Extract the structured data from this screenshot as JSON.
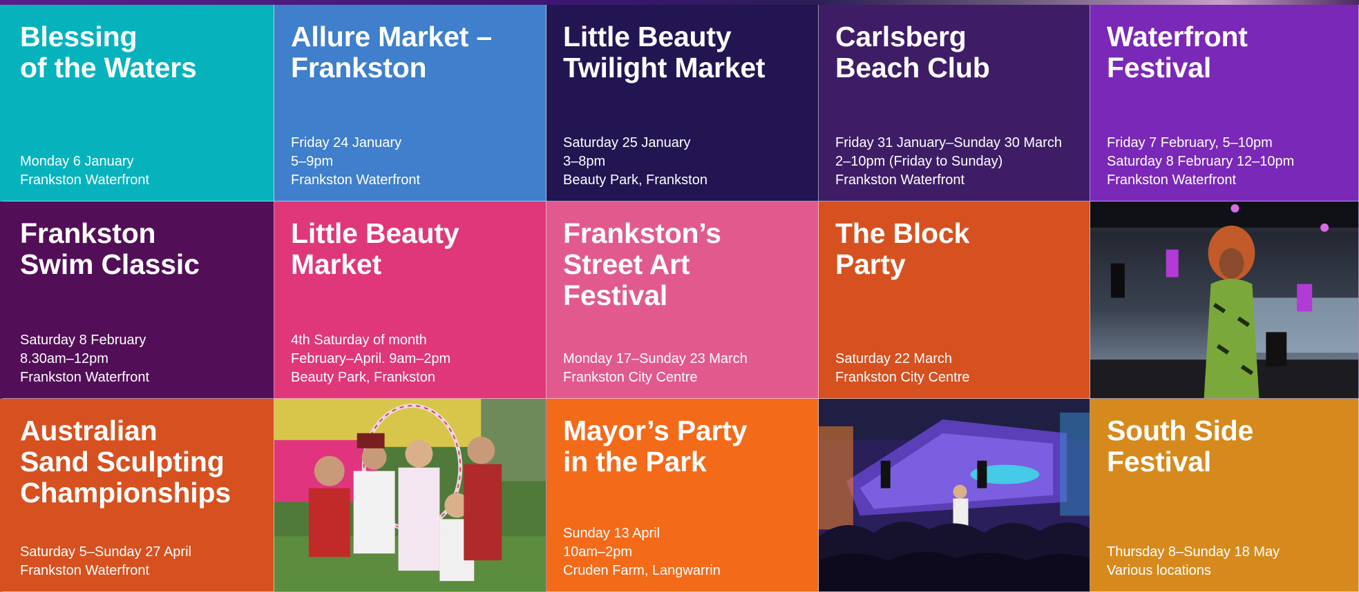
{
  "colors": {
    "teal": "#06b3bd",
    "blue": "#3f7fcb",
    "dark_navy": "#231552",
    "dark_purple": "#3e1d66",
    "purple": "#7a28b8",
    "plum": "#520f57",
    "pink": "#df3779",
    "light_pink": "#e25a8d",
    "burnt_orange": "#d6511f",
    "orange": "#f36a19",
    "mustard": "#d68a1d"
  },
  "events": [
    {
      "title": "Blessing\nof the Waters",
      "details": [
        "Monday 6 January",
        "Frankston Waterfront"
      ]
    },
    {
      "title": "Allure Market –\nFrankston",
      "details": [
        "Friday 24 January",
        "5–9pm",
        "Frankston Waterfront"
      ]
    },
    {
      "title": "Little Beauty\nTwilight Market",
      "details": [
        "Saturday 25 January",
        "3–8pm",
        "Beauty Park, Frankston"
      ]
    },
    {
      "title": "Carlsberg\nBeach Club",
      "details": [
        "Friday 31 January–Sunday 30 March",
        "2–10pm (Friday to Sunday)",
        "Frankston Waterfront"
      ]
    },
    {
      "title": "Waterfront\nFestival",
      "details": [
        "Friday 7 February, 5–10pm",
        "Saturday 8 February 12–10pm",
        "Frankston Waterfront"
      ]
    },
    {
      "title": "Frankston\nSwim Classic",
      "details": [
        "Saturday 8 February",
        "8.30am–12pm",
        "Frankston Waterfront"
      ]
    },
    {
      "title": "Little Beauty\nMarket",
      "details": [
        "4th Saturday of month",
        "February–April. 9am–2pm",
        "Beauty Park, Frankston"
      ]
    },
    {
      "title": "Frankston’s\nStreet Art\nFestival",
      "details": [
        "Monday 17–Sunday 23 March",
        "Frankston City Centre"
      ]
    },
    {
      "title": "The Block\nParty",
      "details": [
        "Saturday 22 March",
        "Frankston City Centre"
      ]
    },
    {
      "title": "Australian\nSand Sculpting\nChampionships",
      "details": [
        "Saturday 5–Sunday 27 April",
        "Frankston Waterfront"
      ]
    },
    {
      "title": "Mayor’s Party\nin the Park",
      "details": [
        "Sunday 13 April",
        "10am–2pm",
        "Cruden Farm, Langwarrin"
      ]
    },
    {
      "title": "South Side\nFestival",
      "details": [
        "Thursday 8–Sunday 18 May",
        "Various locations"
      ]
    }
  ]
}
